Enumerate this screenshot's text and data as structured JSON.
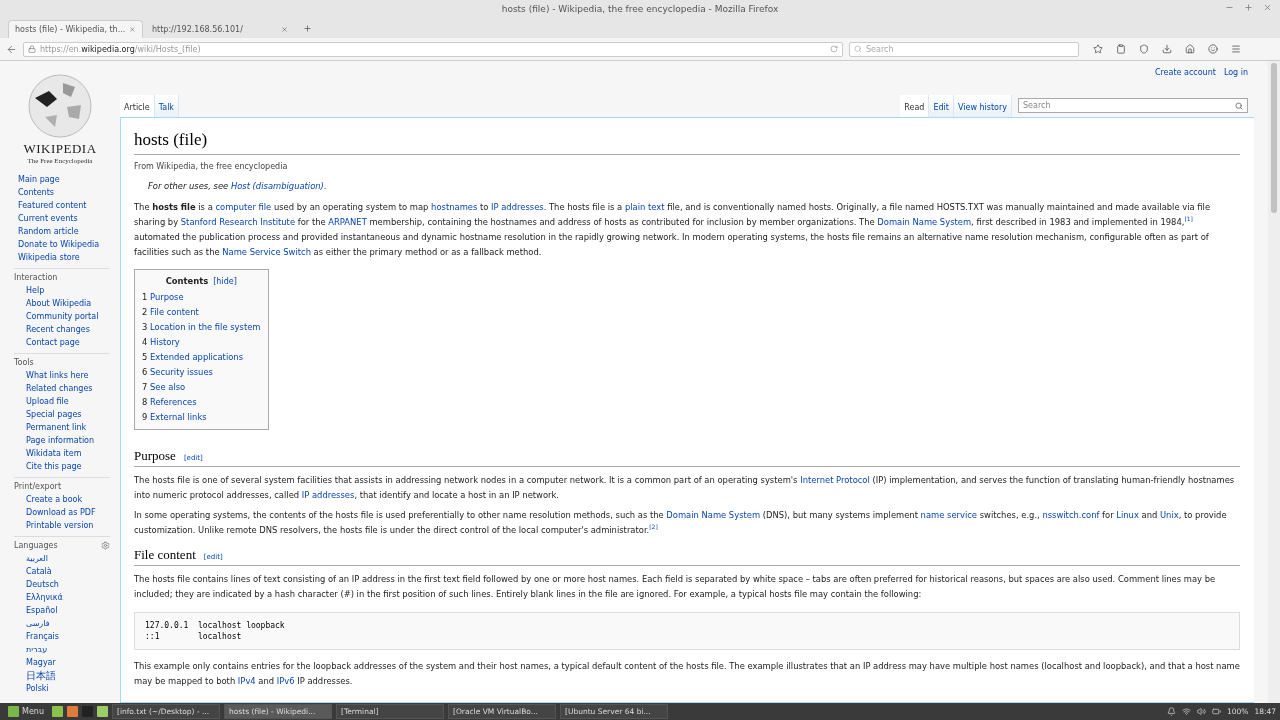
{
  "window": {
    "title": "hosts (file) - Wikipedia, the free encyclopedia - Mozilla Firefox"
  },
  "tabs": [
    {
      "label": "hosts (file) - Wikipedia, th...",
      "selected": true
    },
    {
      "label": "http://192.168.56.101/",
      "selected": false
    }
  ],
  "navbar": {
    "url_prefix": "https://en.",
    "url_domain": "wikipedia.org",
    "url_path": "/wiki/Hosts_(file)",
    "search_placeholder": "Search"
  },
  "page": {
    "personal_links": [
      "Create account",
      "Log in"
    ],
    "logo": {
      "wordmark": "WIKIPEDIA",
      "tagline": "The Free Encyclopedia"
    },
    "main_links": [
      "Main page",
      "Contents",
      "Featured content",
      "Current events",
      "Random article",
      "Donate to Wikipedia",
      "Wikipedia store"
    ],
    "portals": [
      {
        "heading": "Interaction",
        "items": [
          "Help",
          "About Wikipedia",
          "Community portal",
          "Recent changes",
          "Contact page"
        ]
      },
      {
        "heading": "Tools",
        "items": [
          "What links here",
          "Related changes",
          "Upload file",
          "Special pages",
          "Permanent link",
          "Page information",
          "Wikidata item",
          "Cite this page"
        ]
      },
      {
        "heading": "Print/export",
        "items": [
          "Create a book",
          "Download as PDF",
          "Printable version"
        ]
      }
    ],
    "languages": {
      "heading": "Languages",
      "items": [
        "العربية",
        "Català",
        "Deutsch",
        "Ελληνικά",
        "Español",
        "فارسی",
        "Français",
        "עברית",
        "Magyar",
        "日本語",
        "Polski"
      ]
    },
    "namespace_tabs": [
      {
        "label": "Article",
        "selected": true
      },
      {
        "label": "Talk",
        "selected": false
      }
    ],
    "view_tabs": [
      {
        "label": "Read",
        "selected": true
      },
      {
        "label": "Edit",
        "selected": false
      },
      {
        "label": "View history",
        "selected": false
      }
    ],
    "search_placeholder": "Search",
    "article": {
      "title": "hosts (file)",
      "tagline": "From Wikipedia, the free encyclopedia",
      "hatnote": [
        {
          "kind": "plain",
          "text": "For other uses, see "
        },
        {
          "kind": "link",
          "text": "Host (disambiguation)"
        },
        {
          "kind": "plain",
          "text": "."
        }
      ],
      "lead": [
        {
          "kind": "plain",
          "text": "The **hosts file** is a "
        },
        {
          "kind": "link",
          "text": "computer file"
        },
        {
          "kind": "plain",
          "text": " used by an operating system to map "
        },
        {
          "kind": "link",
          "text": "hostnames"
        },
        {
          "kind": "plain",
          "text": " to "
        },
        {
          "kind": "link",
          "text": "IP addresses"
        },
        {
          "kind": "plain",
          "text": ". The hosts file is a "
        },
        {
          "kind": "link",
          "text": "plain text"
        },
        {
          "kind": "plain",
          "text": " file, and is conventionally named hosts. Originally, a file named HOSTS.TXT was manually maintained and made available via file sharing by "
        },
        {
          "kind": "link",
          "text": "Stanford Research Institute"
        },
        {
          "kind": "plain",
          "text": " for the "
        },
        {
          "kind": "link",
          "text": "ARPANET"
        },
        {
          "kind": "plain",
          "text": " membership, containing the hostnames and address of hosts as contributed for inclusion by member organizations. The "
        },
        {
          "kind": "link",
          "text": "Domain Name System"
        },
        {
          "kind": "plain",
          "text": ", first described in 1983 and implemented in 1984,"
        },
        {
          "kind": "ref",
          "text": "[1]"
        },
        {
          "kind": "plain",
          "text": " automated the publication process and provided instantaneous and dynamic hostname resolution in the rapidly growing network. In modern operating systems, the hosts file remains an alternative name resolution mechanism, configurable often as part of facilities such as the "
        },
        {
          "kind": "link",
          "text": "Name Service Switch"
        },
        {
          "kind": "plain",
          "text": " as either the primary method or as a fallback method."
        }
      ],
      "toc": {
        "title": "Contents",
        "toggle": "[hide]",
        "items": [
          {
            "number": "1",
            "label": "Purpose"
          },
          {
            "number": "2",
            "label": "File content"
          },
          {
            "number": "3",
            "label": "Location in the file system"
          },
          {
            "number": "4",
            "label": "History"
          },
          {
            "number": "5",
            "label": "Extended applications"
          },
          {
            "number": "6",
            "label": "Security issues"
          },
          {
            "number": "7",
            "label": "See also"
          },
          {
            "number": "8",
            "label": "References"
          },
          {
            "number": "9",
            "label": "External links"
          }
        ]
      },
      "sections": [
        {
          "heading": "Purpose",
          "edit": "[edit]",
          "blocks": [
            {
              "kind": "paragraph",
              "segments": [
                {
                  "kind": "plain",
                  "text": "The hosts file is one of several system facilities that assists in addressing network nodes in a computer network. It is a common part of an operating system's "
                },
                {
                  "kind": "link",
                  "text": "Internet Protocol"
                },
                {
                  "kind": "plain",
                  "text": " (IP) implementation, and serves the function of translating human-friendly hostnames into numeric protocol addresses, called "
                },
                {
                  "kind": "link",
                  "text": "IP addresses"
                },
                {
                  "kind": "plain",
                  "text": ", that identify and locate a host in an IP network."
                }
              ]
            },
            {
              "kind": "paragraph",
              "segments": [
                {
                  "kind": "plain",
                  "text": "In some operating systems, the contents of the hosts file is used preferentially to other name resolution methods, such as the "
                },
                {
                  "kind": "link",
                  "text": "Domain Name System"
                },
                {
                  "kind": "plain",
                  "text": " (DNS), but many systems implement "
                },
                {
                  "kind": "link",
                  "text": "name service"
                },
                {
                  "kind": "plain",
                  "text": " switches, e.g., "
                },
                {
                  "kind": "link",
                  "text": "nsswitch.conf"
                },
                {
                  "kind": "plain",
                  "text": " for "
                },
                {
                  "kind": "link",
                  "text": "Linux"
                },
                {
                  "kind": "plain",
                  "text": " and "
                },
                {
                  "kind": "link",
                  "text": "Unix"
                },
                {
                  "kind": "plain",
                  "text": ", to provide customization. Unlike remote DNS resolvers, the hosts file is under the direct control of the local computer's administrator."
                },
                {
                  "kind": "ref",
                  "text": "[2]"
                }
              ]
            }
          ]
        },
        {
          "heading": "File content",
          "edit": "[edit]",
          "blocks": [
            {
              "kind": "paragraph",
              "segments": [
                {
                  "kind": "plain",
                  "text": "The hosts file contains lines of text consisting of an IP address in the first text field followed by one or more host names. Each field is separated by white space – tabs are often preferred for historical reasons, but spaces are also used. Comment lines may be included; they are indicated by a hash character (#) in the first position of such lines. Entirely blank lines in the file are ignored. For example, a typical hosts file may contain the following:"
                }
              ]
            },
            {
              "kind": "code",
              "lines": [
                "127.0.0.1  localhost loopback",
                "::1        localhost"
              ]
            },
            {
              "kind": "paragraph",
              "segments": [
                {
                  "kind": "plain",
                  "text": "This example only contains entries for the loopback addresses of the system and their host names, a typical default content of the hosts file. The example illustrates that an IP address may have multiple host names (localhost and loopback), and that a host name may be mapped to both "
                },
                {
                  "kind": "link",
                  "text": "IPv4"
                },
                {
                  "kind": "plain",
                  "text": " and "
                },
                {
                  "kind": "link",
                  "text": "IPv6"
                },
                {
                  "kind": "plain",
                  "text": " IP addresses."
                }
              ]
            }
          ]
        }
      ]
    }
  },
  "taskbar": {
    "menu": "Menu",
    "items": [
      {
        "label": "[info.txt (~/Desktop) - ...",
        "selected": false
      },
      {
        "label": "hosts (file) - Wikipedi...",
        "selected": true
      },
      {
        "label": "[Terminal]",
        "selected": false
      },
      {
        "label": "[Oracle VM VirtualBo...",
        "selected": false
      },
      {
        "label": "[Ubuntu Server 64 bi...",
        "selected": false
      }
    ],
    "battery": "100%",
    "clock": "18:47"
  }
}
